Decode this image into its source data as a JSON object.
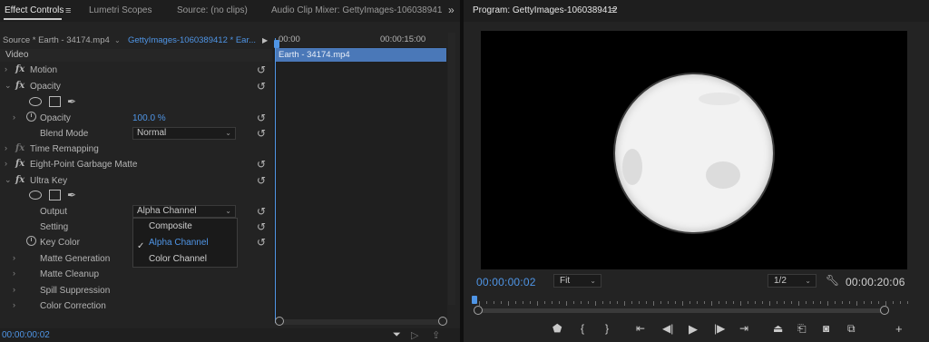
{
  "left_panel": {
    "tabs": [
      {
        "label": "Effect Controls",
        "active": true
      },
      {
        "label": "Lumetri Scopes",
        "active": false
      },
      {
        "label": "Source: (no clips)",
        "active": false
      },
      {
        "label": "Audio Clip Mixer: GettyImages-106038941",
        "active": false
      }
    ],
    "overflow_icon": "»",
    "menu_icon": "≡",
    "source_label": "Source * Earth - 34174.mp4",
    "sequence_label": "GettyImages-1060389412 * Ear...",
    "section_title": "Video",
    "effects": {
      "motion": "Motion",
      "opacity": "Opacity",
      "opacity_param": "Opacity",
      "opacity_value": "100.0 %",
      "blend_mode_label": "Blend Mode",
      "blend_mode_value": "Normal",
      "time_remapping": "Time Remapping",
      "garbage_matte": "Eight-Point Garbage Matte",
      "ultra_key": "Ultra Key",
      "output_label": "Output",
      "output_value": "Alpha Channel",
      "setting_label": "Setting",
      "key_color_label": "Key Color",
      "matte_generation": "Matte Generation",
      "matte_cleanup": "Matte Cleanup",
      "spill_suppression": "Spill Suppression",
      "color_correction": "Color Correction"
    },
    "fx_glyph": "fx",
    "output_options": [
      "Composite",
      "Alpha Channel",
      "Color Channel"
    ],
    "output_selected": "Alpha Channel",
    "timeline": {
      "start_time": "00:00",
      "end_time": "00:00:15:00",
      "clip_name": "Earth - 34174.mp4"
    },
    "current_time": "00:00:00:02"
  },
  "right_panel": {
    "title": "Program: GettyImages-1060389412",
    "menu_icon": "≡",
    "current_time": "00:00:00:02",
    "zoom": "Fit",
    "resolution": "1/2",
    "duration": "00:00:20:06",
    "transport_icons": [
      "marker-icon",
      "in-point-icon",
      "out-point-icon",
      "go-to-in-icon",
      "step-back-icon",
      "play-icon",
      "step-forward-icon",
      "go-to-out-icon",
      "lift-icon",
      "extract-icon",
      "export-frame-icon",
      "compare-icon",
      "add-icon"
    ]
  },
  "colors": {
    "accent_blue": "#4f95e6",
    "clip_blue": "#4a78b8",
    "panel_bg": "#232323"
  }
}
